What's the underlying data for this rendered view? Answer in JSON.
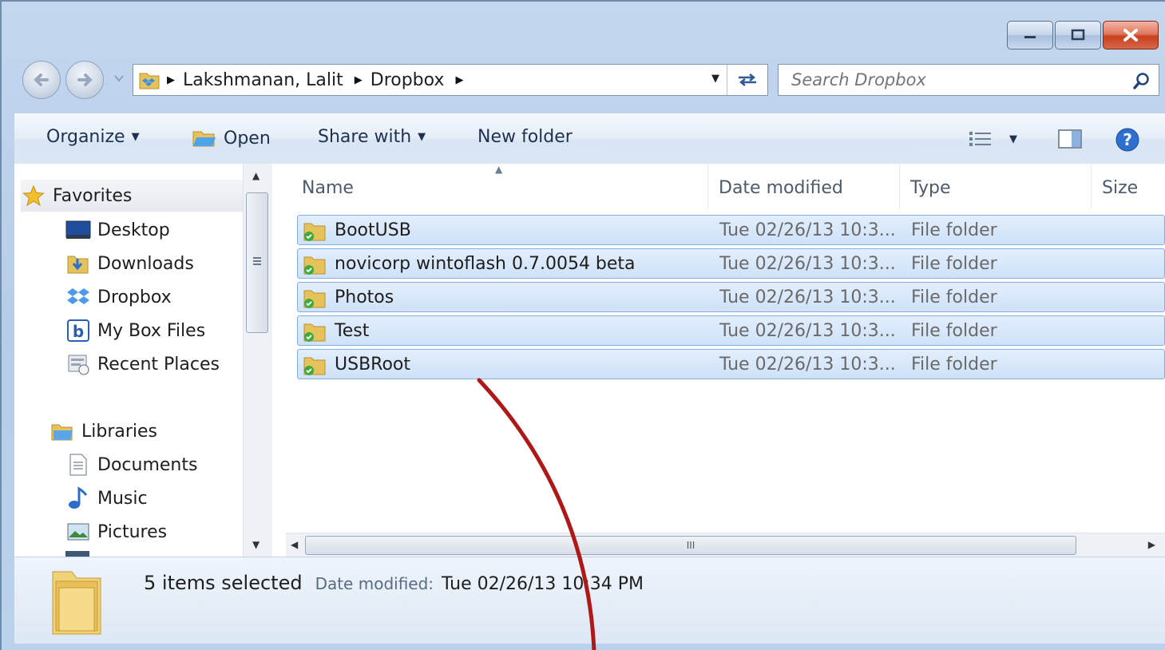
{
  "address": {
    "segments": [
      "Lakshmanan, Lalit",
      "Dropbox"
    ]
  },
  "search": {
    "placeholder": "Search Dropbox"
  },
  "toolbar": {
    "organize": "Organize",
    "open": "Open",
    "share_with": "Share with",
    "new_folder": "New folder"
  },
  "nav": {
    "favorites_label": "Favorites",
    "favorites": [
      "Desktop",
      "Downloads",
      "Dropbox",
      "My Box Files",
      "Recent Places"
    ],
    "libraries_label": "Libraries",
    "libraries": [
      "Documents",
      "Music",
      "Pictures"
    ]
  },
  "columns": {
    "name": "Name",
    "date": "Date modified",
    "type": "Type",
    "size": "Size"
  },
  "files": [
    {
      "name": "BootUSB",
      "date": "Tue 02/26/13 10:3...",
      "type": "File folder"
    },
    {
      "name": "novicorp wintoflash 0.7.0054 beta",
      "date": "Tue 02/26/13 10:3...",
      "type": "File folder"
    },
    {
      "name": "Photos",
      "date": "Tue 02/26/13 10:3...",
      "type": "File folder"
    },
    {
      "name": "Test",
      "date": "Tue 02/26/13 10:3...",
      "type": "File folder"
    },
    {
      "name": "USBRoot",
      "date": "Tue 02/26/13 10:3...",
      "type": "File folder"
    }
  ],
  "details": {
    "count": "5 items selected",
    "date_label": "Date modified:",
    "date_value": "Tue 02/26/13 10:34 PM"
  },
  "colors": {
    "selection": "#cfe2f8",
    "selection_border": "#85aee0",
    "annotation_arrow": "#b01818"
  }
}
